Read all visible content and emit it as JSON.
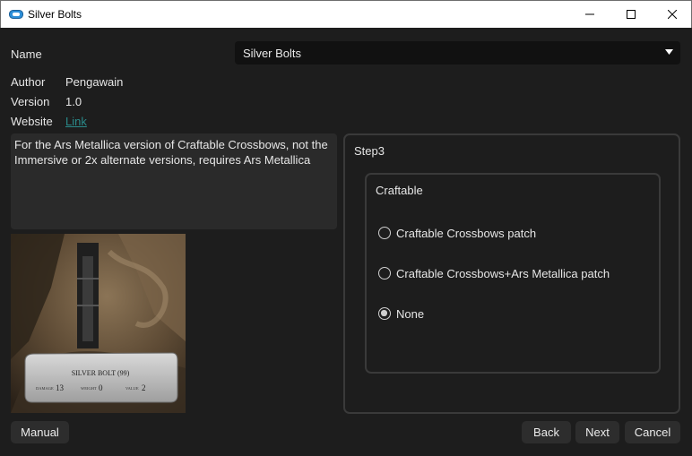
{
  "window": {
    "title": "Silver Bolts",
    "app_icon": "mod-organizer-icon",
    "controls": [
      "minimize-icon",
      "maximize-icon",
      "close-icon"
    ]
  },
  "info": {
    "name_label": "Name",
    "name_value": "Silver Bolts",
    "author_label": "Author",
    "author_value": "Pengawain",
    "version_label": "Version",
    "version_value": "1.0",
    "website_label": "Website",
    "website_link": "Link"
  },
  "description": "For the Ars Metallica version of Craftable Crossbows, not the Immersive or 2x alternate versions, requires Ars Metallica",
  "preview": {
    "title": "SILVER BOLT (99)",
    "damage_label": "DAMAGE",
    "damage_value": "13",
    "weight_label": "WEIGHT",
    "weight_value": "0",
    "value_label": "VALUE",
    "value_value": "2"
  },
  "step": {
    "title": "Step3",
    "group_title": "Craftable",
    "options": [
      {
        "label": "Craftable Crossbows patch",
        "checked": false
      },
      {
        "label": "Craftable Crossbows+Ars Metallica patch",
        "checked": false
      },
      {
        "label": "None",
        "checked": true
      }
    ]
  },
  "buttons": {
    "manual": "Manual",
    "back": "Back",
    "next": "Next",
    "cancel": "Cancel"
  },
  "colors": {
    "background": "#1d1d1d",
    "link": "#2a8a8a",
    "input_bg": "#111111",
    "description_bg": "#2a2a2a",
    "button_bg": "#2d2d2d"
  }
}
